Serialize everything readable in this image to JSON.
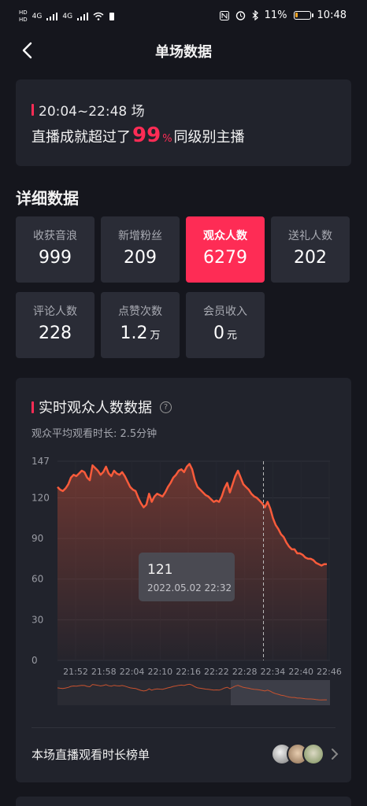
{
  "status": {
    "sim1": "HD",
    "sim2": "HD",
    "signal1": "4G",
    "signal2": "4G",
    "battery": "11%",
    "time": "10:48"
  },
  "nav": {
    "title": "单场数据"
  },
  "summary": {
    "time_range": "20:04~22:48 场",
    "prefix": "直播成就超过了",
    "percent_value": "99",
    "percent_sign": "%",
    "suffix": "同级别主播"
  },
  "details": {
    "title": "详细数据",
    "stats": [
      {
        "label": "收获音浪",
        "value": "999",
        "unit": ""
      },
      {
        "label": "新增粉丝",
        "value": "209",
        "unit": ""
      },
      {
        "label": "观众人数",
        "value": "6279",
        "unit": "",
        "active": true
      },
      {
        "label": "送礼人数",
        "value": "202",
        "unit": ""
      },
      {
        "label": "评论人数",
        "value": "228",
        "unit": ""
      },
      {
        "label": "点赞次数",
        "value": "1.2",
        "unit": "万"
      },
      {
        "label": "会员收入",
        "value": "0",
        "unit": "元"
      }
    ]
  },
  "realtime": {
    "title": "实时观众人数数据",
    "help_icon": "?",
    "subtitle": "观众平均观看时长: 2.5分钟",
    "tooltip": {
      "value": "121",
      "datetime": "2022.05.02 22:32"
    },
    "rank_label": "本场直播观看时长榜单"
  },
  "chart_data": {
    "type": "area",
    "ylim": [
      0,
      147
    ],
    "yticks": [
      0,
      30,
      60,
      90,
      120,
      147
    ],
    "xticks": [
      "21:52",
      "21:58",
      "22:04",
      "22:10",
      "22:16",
      "22:22",
      "22:28",
      "22:34",
      "22:40",
      "22:46"
    ],
    "series": [
      {
        "values": [
          128,
          126,
          125,
          127,
          130,
          135,
          137,
          136,
          138,
          140,
          139,
          135,
          133,
          144,
          142,
          140,
          137,
          139,
          143,
          138,
          136,
          140,
          138,
          137,
          139,
          136,
          132,
          128,
          126,
          125,
          120,
          116,
          113,
          115,
          123,
          117,
          121,
          123,
          122,
          121,
          124,
          128,
          131,
          135,
          137,
          140,
          141,
          139,
          143,
          145,
          141,
          133,
          128,
          126,
          124,
          122,
          121,
          119,
          117,
          118,
          117,
          121,
          127,
          131,
          124,
          130,
          136,
          140,
          135,
          130,
          128,
          126,
          123,
          121,
          120,
          118,
          116,
          113,
          117,
          112,
          105,
          100,
          97,
          93,
          91,
          87,
          84,
          82,
          82,
          79,
          79,
          78,
          76,
          75,
          75,
          74,
          72,
          71,
          70,
          71,
          71
        ]
      }
    ],
    "line_color": "#f85b3b",
    "cursor_time": "22:32",
    "grid": true
  },
  "colors": {
    "accent": "#fe2c55",
    "line": "#f85b3b",
    "background": "#15161d",
    "card": "#21232c"
  }
}
